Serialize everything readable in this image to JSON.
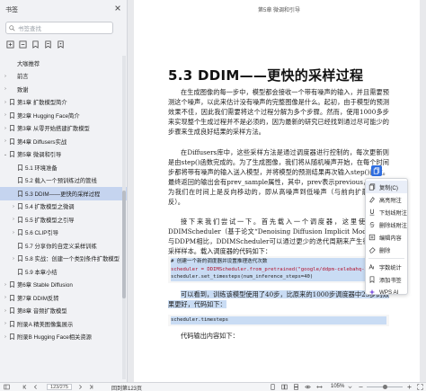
{
  "sidebar": {
    "title": "书签",
    "search_placeholder": "书签查找",
    "items": [
      {
        "label": "大咖推荐",
        "level": 1,
        "arrow": "",
        "marked": false
      },
      {
        "label": "前言",
        "level": 1,
        "arrow": "›",
        "marked": false
      },
      {
        "label": "致谢",
        "level": 1,
        "arrow": "›",
        "marked": false
      },
      {
        "label": "第1章 扩散模型简介",
        "level": 1,
        "arrow": "›",
        "marked": true
      },
      {
        "label": "第2章 Hugging Face简介",
        "level": 1,
        "arrow": "›",
        "marked": true
      },
      {
        "label": "第3章 从零开始搭建扩散模型",
        "level": 1,
        "arrow": "›",
        "marked": true
      },
      {
        "label": "第4章 Diffusers实战",
        "level": 1,
        "arrow": "›",
        "marked": true
      },
      {
        "label": "第5章 微调和引导",
        "level": 1,
        "arrow": "⌄",
        "marked": true
      },
      {
        "label": "5.1 环境准备",
        "level": 2,
        "arrow": "",
        "marked": true
      },
      {
        "label": "5.2 载入一个预训练过的管线",
        "level": 2,
        "arrow": "",
        "marked": true
      },
      {
        "label": "5.3 DDIM——更快的采样过程",
        "level": 2,
        "arrow": "",
        "marked": true,
        "active": true
      },
      {
        "label": "5.4 扩散模型之微调",
        "level": 2,
        "arrow": "›",
        "marked": true
      },
      {
        "label": "5.5 扩散模型之引导",
        "level": 2,
        "arrow": "›",
        "marked": true
      },
      {
        "label": "5.6 CLIP引导",
        "level": 2,
        "arrow": "›",
        "marked": true
      },
      {
        "label": "5.7 分享你的自定义采样训练",
        "level": 2,
        "arrow": "",
        "marked": true
      },
      {
        "label": "5.8 实战：创建一个类别条件扩散模型",
        "level": 2,
        "arrow": "›",
        "marked": true
      },
      {
        "label": "5.9 本章小结",
        "level": 2,
        "arrow": "",
        "marked": true
      },
      {
        "label": "第6章 Stable Diffusion",
        "level": 1,
        "arrow": "›",
        "marked": true
      },
      {
        "label": "第7章 DDIM反转",
        "level": 1,
        "arrow": "›",
        "marked": true
      },
      {
        "label": "第8章 音频扩散模型",
        "level": 1,
        "arrow": "›",
        "marked": true
      },
      {
        "label": "附录A 精美图像集展示",
        "level": 1,
        "arrow": "›",
        "marked": true
      },
      {
        "label": "附录B Hugging Face相关资源",
        "level": 1,
        "arrow": "›",
        "marked": true
      }
    ]
  },
  "page": {
    "header": "第5章 微调和引导",
    "title": "5.3 DDIM——更快的采样过程",
    "p1": "在生成图像的每一步中，模型都会接收一个带有噪声的输入，并且需要预测这个噪声，以此来估计没有噪声的完整图像是什么。起初，由于模型的预测效果不佳，因此我们需要将这个过程分解为多个步骤。然而，使用1000多步来实现整个生成过程并不是必须的，因为最新的研究已经找到通过尽可能少的步骤来生成良好结果的采样方法。",
    "p2": "在Diffusers库中，这些采样方法是通过调度器进行控制的，每次更新则是由step()函数完成的。为了生成图像，我们将从随机噪声开始，在每个时间步都将带有噪声的输入送入模型，并将模型的预测结果再次输入step()函数。最终返回的输出会有prev_sample属性，其中，prev表示previous，这是因为我们在时间上是反向移动的，即从高噪声到低噪声（与前向扩散过程相反）。",
    "p3": "接下来我们尝试一下。首先载入一个调度器，这里使用的是DDIMScheduler（基于论文“Denoising Diffusion Implicit Models”），与DDPM相比，DDIMScheduler可以通过更少的迭代周期来产生很不错的采样样本。载入调度器的代码如下：",
    "code1": [
      "# 创建一个新的调度器并设置推理迭代次数",
      "scheduler = DDIMScheduler.from_pretrained(\"google/ddpm-celebahq-256\")",
      "scheduler.set_timesteps(num_inference_steps=40)"
    ],
    "p4": "可以看到，训练该模型使用了40步，比原来的1000步调度器中25步的效果更好，代码如下：",
    "code2": "scheduler.timesteps",
    "p5": "代码输出内容如下："
  },
  "menu": {
    "items": [
      "复制(C)",
      "高亮附注",
      "下划线附注",
      "删除线附注",
      "编辑内容",
      "删除",
      "字数统计",
      "添加书签",
      "WPS AI"
    ]
  },
  "status": {
    "page_indicator": "123/275",
    "back_link": "回到第123页",
    "zoom": "105%"
  }
}
